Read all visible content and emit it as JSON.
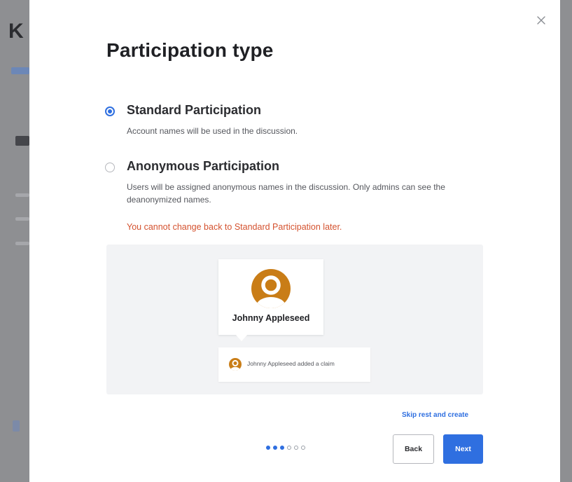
{
  "background": {
    "partial_letter": "K"
  },
  "modal": {
    "title": "Participation type",
    "options": [
      {
        "label": "Standard Participation",
        "description": "Account names will be used in the discussion.",
        "selected": true
      },
      {
        "label": "Anonymous Participation",
        "description": "Users will be assigned anonymous names in the discussion. Only admins can see the deanonymized names.",
        "selected": false
      }
    ],
    "warning": "You cannot change back to Standard Participation later.",
    "preview": {
      "profile_name": "Johnny Appleseed",
      "activity_name": "Johnny Appleseed",
      "activity_action": "added a claim",
      "avatar_color": "#c97d17"
    },
    "skip_label": "Skip rest and create",
    "stepper": {
      "total_steps": 6,
      "current_step": 3
    },
    "back_label": "Back",
    "next_label": "Next"
  },
  "colors": {
    "accent": "#2f6fe0",
    "warning": "#d4522f",
    "title": "#1f2024",
    "preview_bg": "#f2f3f5"
  }
}
